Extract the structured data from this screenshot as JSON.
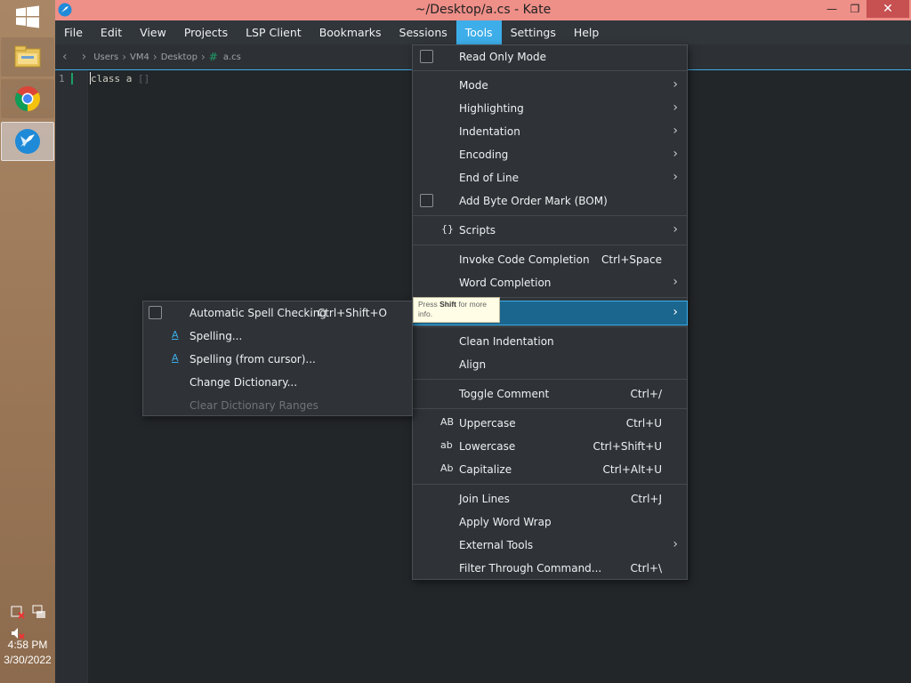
{
  "window": {
    "title": "~/Desktop/a.cs  - Kate",
    "controls": {
      "minimize": "—",
      "maximize": "❐",
      "close": "✕"
    }
  },
  "menubar": [
    "File",
    "Edit",
    "View",
    "Projects",
    "LSP Client",
    "Bookmarks",
    "Sessions",
    "Tools",
    "Settings",
    "Help"
  ],
  "active_menu": "Tools",
  "breadcrumb": [
    "Users",
    "VM4",
    "Desktop",
    "a.cs"
  ],
  "editor": {
    "line_number": "1",
    "code": "class a ",
    "fold": "[]"
  },
  "tools_menu": {
    "read_only": "Read Only Mode",
    "mode": "Mode",
    "highlighting": "Highlighting",
    "indentation": "Indentation",
    "encoding": "Encoding",
    "end_of_line": "End of Line",
    "bom": "Add Byte Order Mark (BOM)",
    "scripts_icon": "{}",
    "scripts": "Scripts",
    "invoke": "Invoke Code Completion",
    "invoke_sc": "Ctrl+Space",
    "word_completion": "Word Completion",
    "spelling": "",
    "clean_indent": "Clean Indentation",
    "align": "Align",
    "toggle_comment": "Toggle Comment",
    "toggle_comment_sc": "Ctrl+/",
    "uppercase_icon": "AB",
    "uppercase": "Uppercase",
    "uppercase_sc": "Ctrl+U",
    "lowercase_icon": "ab",
    "lowercase": "Lowercase",
    "lowercase_sc": "Ctrl+Shift+U",
    "capitalize_icon": "Ab",
    "capitalize": "Capitalize",
    "capitalize_sc": "Ctrl+Alt+U",
    "join_lines": "Join Lines",
    "join_lines_sc": "Ctrl+J",
    "word_wrap": "Apply Word Wrap",
    "external_tools": "External Tools",
    "filter": "Filter Through Command...",
    "filter_sc": "Ctrl+\\"
  },
  "spell_menu": {
    "auto": "Automatic Spell Checking",
    "auto_sc": "Ctrl+Shift+O",
    "spell_icon": "A",
    "spelling": "Spelling...",
    "spelling_cursor": "Spelling (from cursor)...",
    "change_dict": "Change Dictionary...",
    "clear_ranges": "Clear Dictionary Ranges"
  },
  "tooltip": {
    "press": "Press ",
    "shift": "Shift",
    "rest": " for more info."
  },
  "tray": {
    "time": "4:58 PM",
    "date": "3/30/2022"
  },
  "colors": {
    "accent": "#3daee9",
    "titlebar": "#ee8f88",
    "menu_bg": "#2f3338",
    "editor_bg": "#232629"
  }
}
